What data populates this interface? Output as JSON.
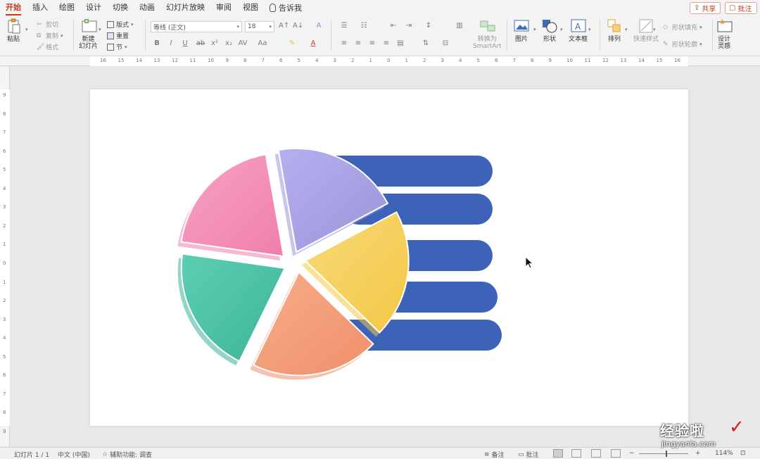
{
  "tabs": [
    {
      "label": "开始",
      "active": true
    },
    {
      "label": "插入"
    },
    {
      "label": "绘图"
    },
    {
      "label": "设计"
    },
    {
      "label": "切换"
    },
    {
      "label": "动画"
    },
    {
      "label": "幻灯片放映"
    },
    {
      "label": "审阅"
    },
    {
      "label": "视图"
    }
  ],
  "tell_me": "告诉我",
  "share_label": "共享",
  "comments_label": "批注",
  "ribbon": {
    "paste": "粘贴",
    "cut": "剪切",
    "copy": "复制",
    "format": "格式",
    "new_slide": "新建\n幻灯片",
    "layout": "版式",
    "reset": "重置",
    "section": "节",
    "font_name": "等线 (正文)",
    "font_size": "18",
    "convert_smartart": "转换为\nSmartArt",
    "picture": "图片",
    "shape": "形状",
    "textbox": "文本框",
    "arrange": "排列",
    "quick_styles": "快速样式",
    "shape_fill": "形状填充",
    "shape_outline": "形状轮廓",
    "designer": "设计\n灵感"
  },
  "ruler_h": [
    "16",
    "15",
    "14",
    "13",
    "12",
    "11",
    "10",
    "9",
    "8",
    "7",
    "6",
    "5",
    "4",
    "3",
    "2",
    "1",
    "0",
    "1",
    "2",
    "3",
    "4",
    "5",
    "6",
    "7",
    "8",
    "9",
    "10",
    "11",
    "12",
    "13",
    "14",
    "15",
    "16"
  ],
  "ruler_v": [
    "9",
    "8",
    "7",
    "6",
    "5",
    "4",
    "3",
    "2",
    "1",
    "0",
    "1",
    "2",
    "3",
    "4",
    "5",
    "6",
    "7",
    "8",
    "9"
  ],
  "slide": {
    "pie_slices": [
      {
        "name": "slice-purple",
        "color_a": "#b4b0f0",
        "color_b": "#9c95d8",
        "share": 0.2
      },
      {
        "name": "slice-yellow",
        "color_a": "#f7d97a",
        "color_b": "#f3c844",
        "share": 0.2
      },
      {
        "name": "slice-orange",
        "color_a": "#f7ad8a",
        "color_b": "#f08f6a",
        "share": 0.2
      },
      {
        "name": "slice-teal",
        "color_a": "#5ccfb3",
        "color_b": "#3db497",
        "share": 0.2
      },
      {
        "name": "slice-pink",
        "color_a": "#f7a2c4",
        "color_b": "#f07fab",
        "share": 0.2
      }
    ],
    "bar_color": "#3d63b9",
    "bar_count": 5
  },
  "status": {
    "slide_info": "幻灯片 1 / 1",
    "language": "中文 (中国)",
    "accessibility": "辅助功能: 调查",
    "notes": "备注",
    "comments": "批注",
    "zoom": "114%"
  },
  "watermark": {
    "cn": "经验啦",
    "url": "jingyanla.com"
  }
}
